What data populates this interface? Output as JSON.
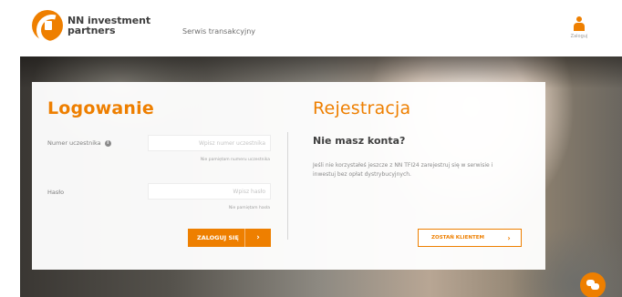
{
  "header": {
    "logo_line1": "NN investment",
    "logo_line2": "partners",
    "service_link": "Serwis transakcyjny",
    "user_label": "Zaloguj"
  },
  "login": {
    "title": "Logowanie",
    "participant_label": "Numer uczestnika",
    "participant_placeholder": "Wpisz numer uczestnika",
    "participant_help": "Nie pamiętam numeru uczestnika",
    "password_label": "Hasło",
    "password_placeholder": "Wpisz hasło",
    "password_help": "Nie pamiętam hasła",
    "submit_label": "ZALOGUJ SIĘ",
    "submit_arrow": "›"
  },
  "register": {
    "title": "Rejestracja",
    "subtitle": "Nie masz konta?",
    "text": "Jeśli nie korzystałeś jeszcze z NN TFI24 zarejestruj się w serwisie i inwestuj bez opłat dystrybucyjnych.",
    "button_label": "ZOSTAŃ KLIENTEM",
    "button_arrow": "›"
  },
  "colors": {
    "accent": "#ee7f00",
    "heading_dark": "#404040"
  },
  "icons": [
    "nn-logo-icon",
    "user-icon",
    "info-icon",
    "chevron-right-icon",
    "chat-icon"
  ]
}
